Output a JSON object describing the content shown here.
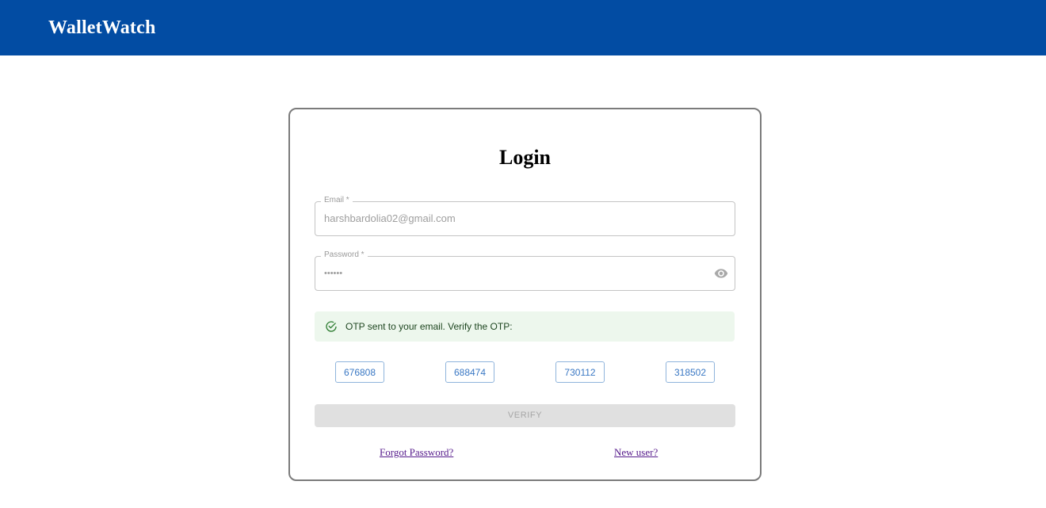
{
  "header": {
    "brand": "WalletWatch"
  },
  "login": {
    "title": "Login",
    "email": {
      "label": "Email *",
      "value": "harshbardolia02@gmail.com"
    },
    "password": {
      "label": "Password *",
      "value": "••••••",
      "toggle_icon": "eye-icon"
    },
    "alert": {
      "icon": "check-circle-icon",
      "text": "OTP sent to your email. Verify the OTP:",
      "color": "#edf7ed"
    },
    "otp_options": [
      "676808",
      "688474",
      "730112",
      "318502"
    ],
    "verify_label": "VERIFY",
    "links": {
      "forgot": "Forgot Password?",
      "new_user": "New user?"
    }
  },
  "colors": {
    "header_bg": "#024ca3",
    "link": "#551a8b",
    "otp_text": "#3a78c4",
    "success_icon": "#2e7d32"
  }
}
